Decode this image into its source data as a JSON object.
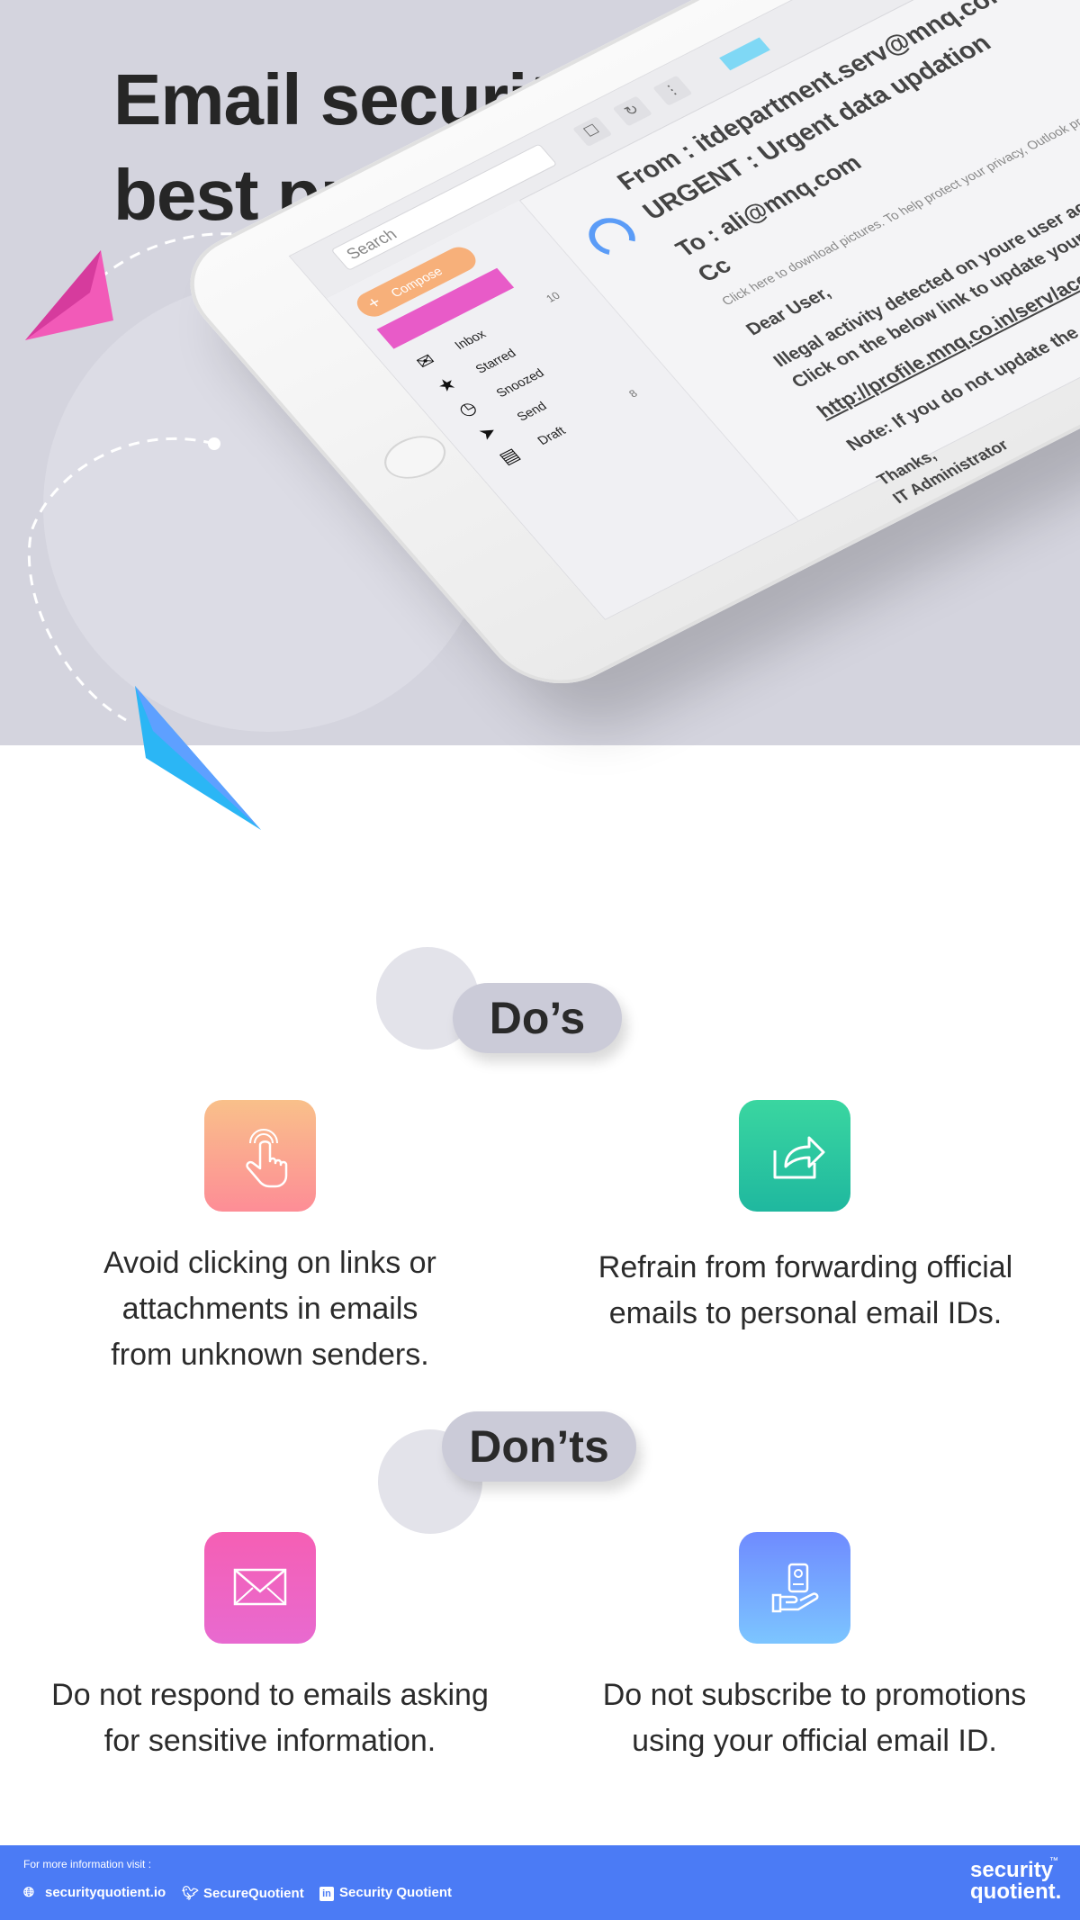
{
  "header": {
    "title_line1": "Email security",
    "title_line2": "best practices"
  },
  "tablet_email": {
    "search_placeholder": "Search",
    "compose_label": "Compose",
    "folders": [
      {
        "icon": "inbox-icon",
        "label": "Inbox",
        "count": "10"
      },
      {
        "icon": "star-icon",
        "label": "Starred",
        "count": ""
      },
      {
        "icon": "clock-icon",
        "label": "Snoozed",
        "count": ""
      },
      {
        "icon": "send-icon",
        "label": "Send",
        "count": ""
      },
      {
        "icon": "draft-icon",
        "label": "Draft",
        "count": "8"
      }
    ],
    "from": "From :  itdepartment.serv@mnq.com",
    "subject": "URGENT :  Urgent data updation",
    "to": "To : ali@mnq.com",
    "cc": "Cc",
    "privacy_note": "Click here to download pictures. To help protect your privacy, Outlook prevented automatic download of some pictures in this message.",
    "greeting": "Dear User,",
    "body_line1": "Illegal activity detected on youre user account.",
    "body_line2": "Click on the below link to update your user ID and password",
    "link": "http://profile.mnq.co.in/serv/account",
    "warning": "Note: If you do not update the details your account will be blocked.",
    "sign_off": "Thanks,",
    "signature": "IT Administrator"
  },
  "dos": {
    "heading": "Do’s",
    "items": [
      {
        "icon": "tap-hand-icon",
        "text_lines": [
          "Avoid clicking on links or",
          "attachments in emails",
          "from unknown senders."
        ]
      },
      {
        "icon": "forward-share-icon",
        "text_lines": [
          "Refrain from forwarding official",
          "emails to personal email IDs."
        ]
      }
    ]
  },
  "donts": {
    "heading": "Don’ts",
    "items": [
      {
        "icon": "envelope-icon",
        "text_lines": [
          "Do not respond to emails asking",
          "for sensitive information."
        ]
      },
      {
        "icon": "hand-card-icon",
        "text_lines": [
          "Do not subscribe to promotions",
          "using your official email ID."
        ]
      }
    ]
  },
  "footer": {
    "more_info": "For more information visit :",
    "website": "securityquotient.io",
    "twitter": "SecureQuotient",
    "linkedin": "Security Quotient",
    "brand_line1": "security",
    "brand_line2": "quotient.",
    "trademark": "™"
  },
  "colors": {
    "hero_background": "#d4d4de",
    "footer_blue": "#4b7bf5",
    "pill_grey": "#cbcbd8",
    "tile_orange": [
      "#f9c08a",
      "#fd8d96"
    ],
    "tile_green": [
      "#3ad6a0",
      "#1fb89f"
    ],
    "tile_pink": [
      "#f55fb4",
      "#e86ad0"
    ],
    "tile_blue": [
      "#6f8bff",
      "#7cc5ff"
    ]
  }
}
